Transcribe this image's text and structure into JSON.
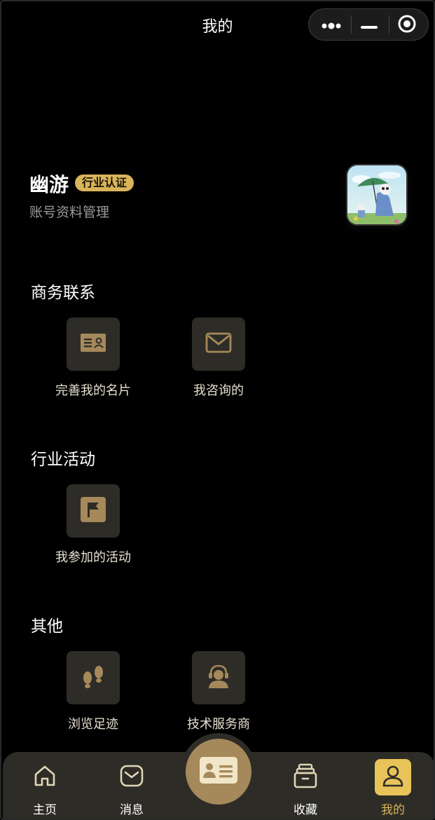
{
  "header": {
    "title": "我的"
  },
  "capsule": {
    "more_icon": "more-dots-icon",
    "minimize_icon": "minimize-icon",
    "close_icon": "target-circle-icon"
  },
  "profile": {
    "name": "幽游",
    "badge": "行业认证",
    "subtitle": "账号资料管理",
    "avatar_icon": "avatar-image"
  },
  "sections": {
    "business": {
      "title": "商务联系",
      "items": [
        {
          "label": "完善我的名片",
          "icon": "id-card-icon"
        },
        {
          "label": "我咨询的",
          "icon": "mail-icon"
        }
      ]
    },
    "activity": {
      "title": "行业活动",
      "items": [
        {
          "label": "我参加的活动",
          "icon": "flag-icon"
        }
      ]
    },
    "other": {
      "title": "其他",
      "items": [
        {
          "label": "浏览足迹",
          "icon": "footprints-icon"
        },
        {
          "label": "技术服务商",
          "icon": "headset-agent-icon"
        }
      ]
    }
  },
  "tabbar": {
    "items": [
      {
        "label": "主页",
        "icon": "home-icon"
      },
      {
        "label": "消息",
        "icon": "message-icon"
      },
      {
        "label": "",
        "icon": "business-card-icon"
      },
      {
        "label": "收藏",
        "icon": "archive-box-icon"
      },
      {
        "label": "我的",
        "icon": "user-icon",
        "active": true
      }
    ]
  },
  "colors": {
    "accent": "#d9b55a",
    "tile_bg": "#2e2c27",
    "icon_gold": "#a6895a",
    "background": "#000000"
  }
}
